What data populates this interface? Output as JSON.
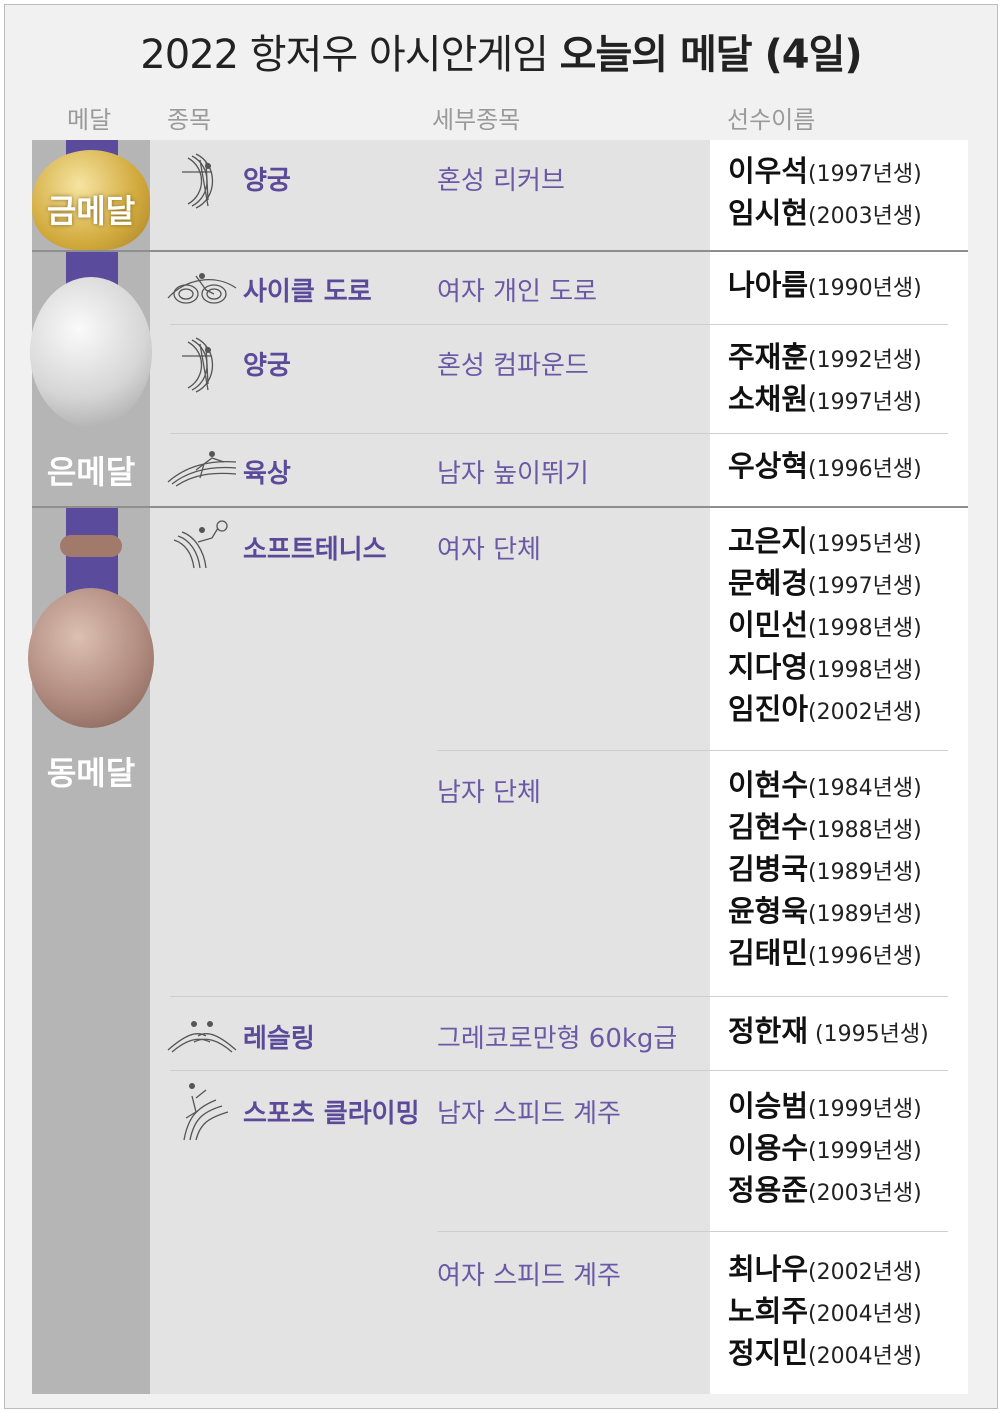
{
  "title": {
    "regular": "2022 항저우 아시안게임 ",
    "bold": "오늘의 메달 (4일)"
  },
  "headers": {
    "medal": "메달",
    "sport": "종목",
    "event": "세부종목",
    "athlete": "선수이름"
  },
  "colors": {
    "accent": "#5b4a9a",
    "ribbon": "#5b4b9c",
    "gold": "#d8b44a",
    "silver": "#d8d8d8",
    "bronze": "#b08a7e"
  },
  "medals": {
    "gold": "금메달",
    "silver": "은메달",
    "bronze": "동메달"
  },
  "rows": [
    {
      "icon": "archery-icon",
      "sport": "양궁",
      "event": "혼성 리커브",
      "athletes": [
        {
          "name": "이우석",
          "year": "(1997년생)"
        },
        {
          "name": "임시현",
          "year": "(2003년생)"
        }
      ]
    },
    {
      "icon": "cycling-icon",
      "sport": "사이클 도로",
      "event": "여자 개인 도로",
      "athletes": [
        {
          "name": "나아름",
          "year": "(1990년생)"
        }
      ]
    },
    {
      "icon": "archery-icon",
      "sport": "양궁",
      "event": "혼성 컴파운드",
      "athletes": [
        {
          "name": "주재훈",
          "year": "(1992년생)"
        },
        {
          "name": "소채원",
          "year": "(1997년생)"
        }
      ]
    },
    {
      "icon": "athletics-icon",
      "sport": "육상",
      "event": "남자 높이뛰기",
      "athletes": [
        {
          "name": "우상혁",
          "year": "(1996년생)"
        }
      ]
    },
    {
      "icon": "soft-tennis-icon",
      "sport": "소프트테니스",
      "event": "여자 단체",
      "athletes": [
        {
          "name": "고은지",
          "year": "(1995년생)"
        },
        {
          "name": "문혜경",
          "year": "(1997년생)"
        },
        {
          "name": "이민선",
          "year": "(1998년생)"
        },
        {
          "name": "지다영",
          "year": "(1998년생)"
        },
        {
          "name": "임진아",
          "year": "(2002년생)"
        }
      ]
    },
    {
      "event": "남자 단체",
      "athletes": [
        {
          "name": "이현수",
          "year": "(1984년생)"
        },
        {
          "name": "김현수",
          "year": "(1988년생)"
        },
        {
          "name": "김병국",
          "year": "(1989년생)"
        },
        {
          "name": "윤형욱",
          "year": "(1989년생)"
        },
        {
          "name": "김태민",
          "year": "(1996년생)"
        }
      ]
    },
    {
      "icon": "wrestling-icon",
      "sport": "레슬링",
      "event": "그레코로만형 60kg급",
      "athletes": [
        {
          "name": "정한재",
          "year": " (1995년생)"
        }
      ]
    },
    {
      "icon": "sport-climbing-icon",
      "sport": "스포츠 클라이밍",
      "event": "남자 스피드 계주",
      "athletes": [
        {
          "name": "이승범",
          "year": "(1999년생)"
        },
        {
          "name": "이용수",
          "year": "(1999년생)"
        },
        {
          "name": "정용준",
          "year": "(2003년생)"
        }
      ]
    },
    {
      "event": "여자 스피드 계주",
      "athletes": [
        {
          "name": "최나우",
          "year": "(2002년생)"
        },
        {
          "name": "노희주",
          "year": "(2004년생)"
        },
        {
          "name": "정지민",
          "year": "(2004년생)"
        }
      ]
    }
  ]
}
